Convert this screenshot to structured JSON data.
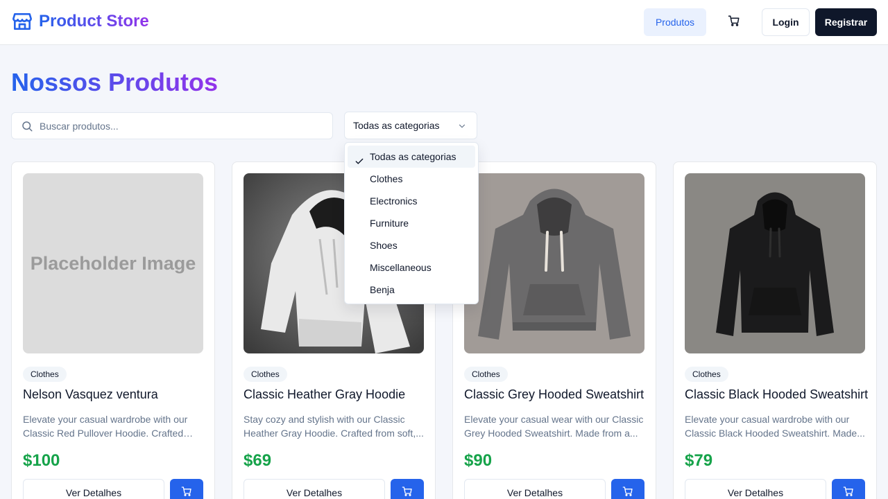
{
  "header": {
    "brand": "Product Store",
    "nav_products": "Produtos",
    "login": "Login",
    "register": "Registrar",
    "cart_icon": "cart-icon",
    "brand_icon": "store-icon"
  },
  "page": {
    "title": "Nossos Produtos"
  },
  "search": {
    "placeholder": "Buscar produtos...",
    "value": ""
  },
  "category_select": {
    "selected": "Todas as categorias",
    "options": [
      "Todas as categorias",
      "Clothes",
      "Electronics",
      "Furniture",
      "Shoes",
      "Miscellaneous",
      "Benja"
    ]
  },
  "products": [
    {
      "category": "Clothes",
      "title": "Nelson Vasquez ventura",
      "description": "Elevate your casual wardrobe with our Classic Red Pullover Hoodie. Crafted wit...",
      "price": "$100",
      "image_text": "Placeholder Image",
      "details_label": "Ver Detalhes"
    },
    {
      "category": "Clothes",
      "title": "Classic Heather Gray Hoodie",
      "description": "Stay cozy and stylish with our Classic Heather Gray Hoodie. Crafted from soft,...",
      "price": "$69",
      "details_label": "Ver Detalhes"
    },
    {
      "category": "Clothes",
      "title": "Classic Grey Hooded Sweatshirt",
      "description": "Elevate your casual wear with our Classic Grey Hooded Sweatshirt. Made from a...",
      "price": "$90",
      "details_label": "Ver Detalhes"
    },
    {
      "category": "Clothes",
      "title": "Classic Black Hooded Sweatshirt",
      "description": "Elevate your casual wardrobe with our Classic Black Hooded Sweatshirt. Made...",
      "price": "$79",
      "details_label": "Ver Detalhes"
    }
  ],
  "colors": {
    "accent": "#2563eb",
    "brand_gradient_end": "#9333ea",
    "price": "#16a34a",
    "dark_button": "#0f172a"
  }
}
